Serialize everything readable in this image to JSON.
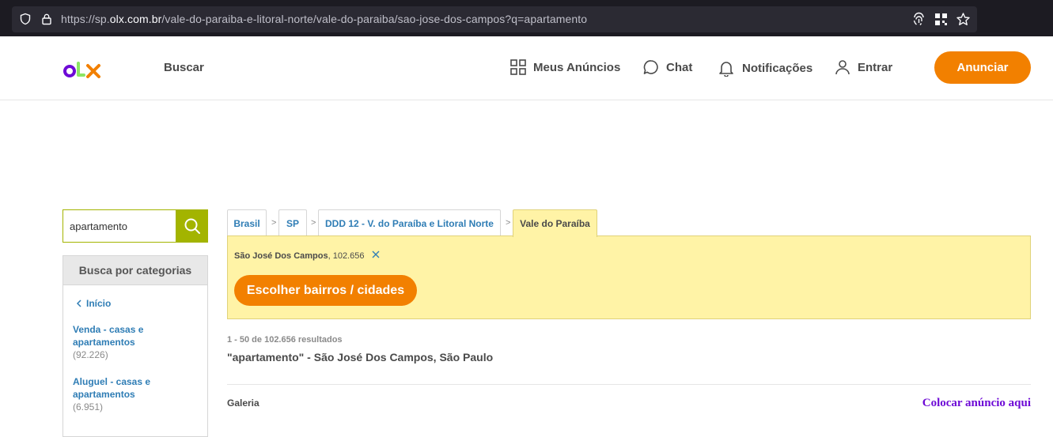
{
  "browser": {
    "url_prefix": "https://sp.",
    "url_host": "olx.com.br",
    "url_path": "/vale-do-paraiba-e-litoral-norte/vale-do-paraiba/sao-jose-dos-campos?q=apartamento",
    "icons": [
      "shield-icon",
      "lock-icon",
      "fingerprint-icon",
      "qr-code-icon",
      "bookmark-star-icon"
    ]
  },
  "header": {
    "logo_colors": [
      "#6e0ad6",
      "#8ce563",
      "#f28000"
    ],
    "buscar": "Buscar",
    "nav": {
      "meus_anuncios": "Meus Anúncios",
      "chat": "Chat",
      "notificacoes": "Notificações",
      "entrar": "Entrar"
    },
    "anunciar": "Anunciar"
  },
  "sidebar": {
    "search_value": "apartamento",
    "categories_title": "Busca por categorias",
    "inicio": "Início",
    "items": [
      {
        "label": "Venda - casas e apartamentos",
        "count": "(92.226)"
      },
      {
        "label": "Aluguel - casas e apartamentos",
        "count": "(6.951)"
      }
    ]
  },
  "breadcrumb": {
    "items": [
      "Brasil",
      "SP",
      "DDD 12 - V. do Paraíba e Litoral Norte",
      "Vale do Paraíba"
    ],
    "separator": ">"
  },
  "location_filter": {
    "name": "São José Dos Campos",
    "count": ", 102.656",
    "button": "Escolher bairros / cidades"
  },
  "results": {
    "count_text": "1 - 50 de 102.656 resultados",
    "title": "\"apartamento\" - São José Dos Campos, São Paulo",
    "view_mode": "Galeria",
    "place_ad": "Colocar anúncio aqui"
  },
  "colors": {
    "accent_orange": "#f28000",
    "purple": "#6e0ad6",
    "search_green": "#a3b400",
    "yellow_panel": "#fff3a6",
    "link_blue": "#2f7db5"
  }
}
